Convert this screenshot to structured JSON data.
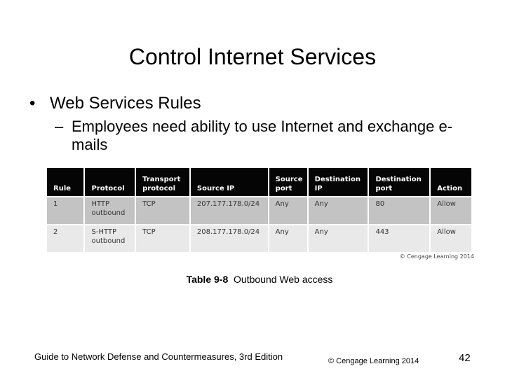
{
  "slide": {
    "title": "Control Internet Services",
    "bullet_symbol": "•",
    "bullet": "Web Services Rules",
    "sub_bullet_symbol": "–",
    "sub_bullet": "Employees need ability to use Internet and exchange e-mails"
  },
  "table": {
    "headers": [
      "Rule",
      "Protocol",
      "Transport protocol",
      "Source IP",
      "Source port",
      "Destination IP",
      "Destination port",
      "Action"
    ],
    "rows": [
      [
        "1",
        "HTTP outbound",
        "TCP",
        "207.177.178.0/24",
        "Any",
        "Any",
        "80",
        "Allow"
      ],
      [
        "2",
        "S-HTTP outbound",
        "TCP",
        "208.177.178.0/24",
        "Any",
        "Any",
        "443",
        "Allow"
      ]
    ],
    "credit": "© Cengage Learning 2014"
  },
  "caption": {
    "label": "Table 9-8",
    "text": "Outbound Web access"
  },
  "footer": {
    "book": "Guide to Network Defense and Countermeasures, 3rd Edition",
    "copyright": "© Cengage Learning  2014",
    "page_number": "42"
  }
}
